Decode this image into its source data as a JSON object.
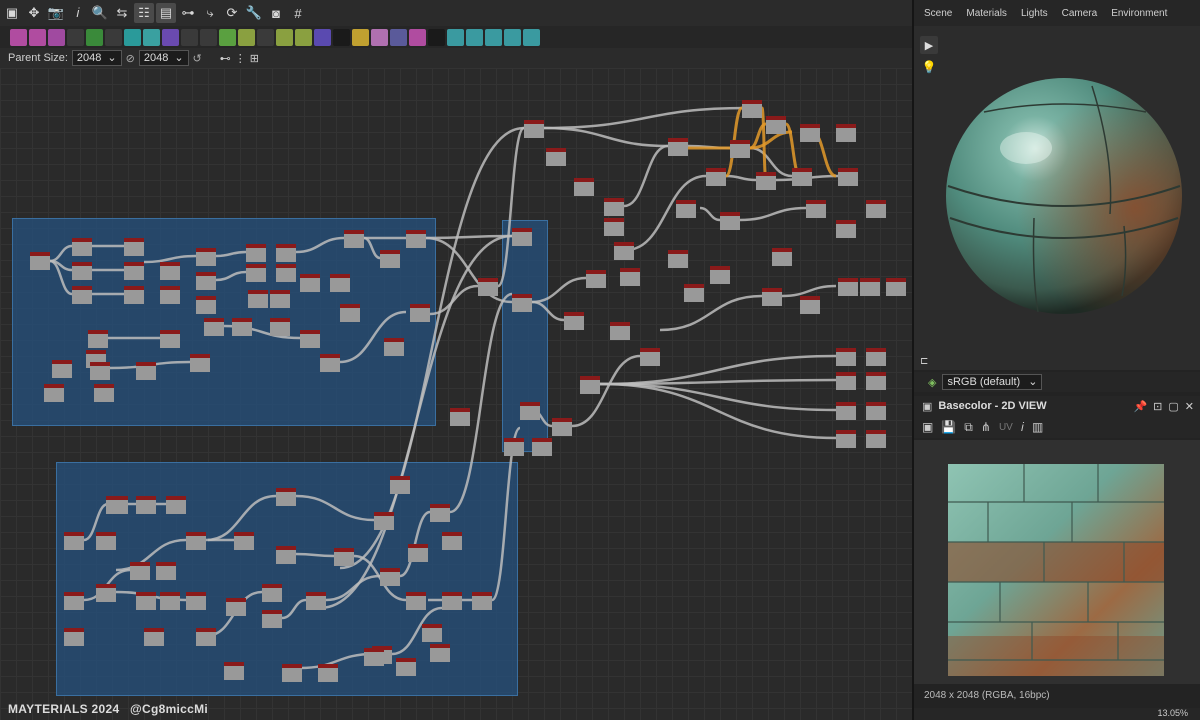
{
  "toolbar": {
    "icons": [
      "select-icon",
      "move-icon",
      "camera-icon",
      "info-icon",
      "zoom-icon",
      "link-icon",
      "layout-icon",
      "panel-icon",
      "connector-icon",
      "route-icon",
      "refresh-icon",
      "wrench-icon",
      "frame-icon",
      "grid-icon"
    ]
  },
  "node_toolbar": {
    "icons": [
      {
        "name": "image-node-icon",
        "color": "#b04ca0"
      },
      {
        "name": "uniform-node-icon",
        "color": "#b04ca0"
      },
      {
        "name": "drop-node-icon",
        "color": "#a04aa0"
      },
      {
        "name": "shuffle-node-icon",
        "color": "#3a3a3a"
      },
      {
        "name": "curve-node-icon",
        "color": "#3a8a3a"
      },
      {
        "name": "blur-node-icon",
        "color": "#3a3a3a"
      },
      {
        "name": "warp-node-icon",
        "color": "#2a9a9a"
      },
      {
        "name": "transform-node-icon",
        "color": "#3aa0a0"
      },
      {
        "name": "circle-node-icon",
        "color": "#6a4ab0"
      },
      {
        "name": "grid-node-icon",
        "color": "#3a3a3a"
      },
      {
        "name": "shape-node-icon",
        "color": "#3a3a3a"
      },
      {
        "name": "blend-node-icon",
        "color": "#5aa040"
      },
      {
        "name": "levels-node-icon",
        "color": "#8aa040"
      },
      {
        "name": "gradient-node-icon",
        "color": "#3a3a3a"
      },
      {
        "name": "mask-node-icon",
        "color": "#8aa040"
      },
      {
        "name": "histogram-node-icon",
        "color": "#8aa040"
      },
      {
        "name": "color-node-icon",
        "color": "#5a4ab0"
      },
      {
        "name": "noise-node-icon",
        "color": "#1a1a1a"
      },
      {
        "name": "warning-node-icon",
        "color": "#c0a030"
      },
      {
        "name": "text-node-icon",
        "color": "#b070b0"
      },
      {
        "name": "select-node-icon",
        "color": "#5a5a9a"
      },
      {
        "name": "fill-node-icon",
        "color": "#b04ca0"
      },
      {
        "name": "bitmap-node-icon",
        "color": "#1a1a1a"
      },
      {
        "name": "output-node-icon",
        "color": "#3a9aa0"
      },
      {
        "name": "normal-node-icon",
        "color": "#3a9aa0"
      },
      {
        "name": "height-node-icon",
        "color": "#3a9aa0"
      },
      {
        "name": "ao-node-icon",
        "color": "#3a9aa0"
      },
      {
        "name": "curvature-node-icon",
        "color": "#3a9aa0"
      }
    ]
  },
  "parent_size": {
    "label": "Parent Size:",
    "width": "2048",
    "height": "2048"
  },
  "watermark": {
    "left": "MAYTERIALS 2024",
    "right": "@Cg8miccMi"
  },
  "right_panel": {
    "tabs": [
      "Scene",
      "Materials",
      "Lights",
      "Camera",
      "Environment"
    ],
    "color_space": "sRGB (default)",
    "view2d_title": "Basecolor - 2D VIEW",
    "uv_label": "UV",
    "texture_info": "2048 x 2048 (RGBA, 16bpc)",
    "zoom": "13.05%"
  },
  "colors": {
    "frame_blue": "#2d5a86",
    "node_header_red": "#8a1a1a",
    "wire": "#bdbdbd",
    "wire_highlight": "#e39a2a",
    "copper_green": "#5fa091",
    "rust": "#8a4a2a"
  }
}
